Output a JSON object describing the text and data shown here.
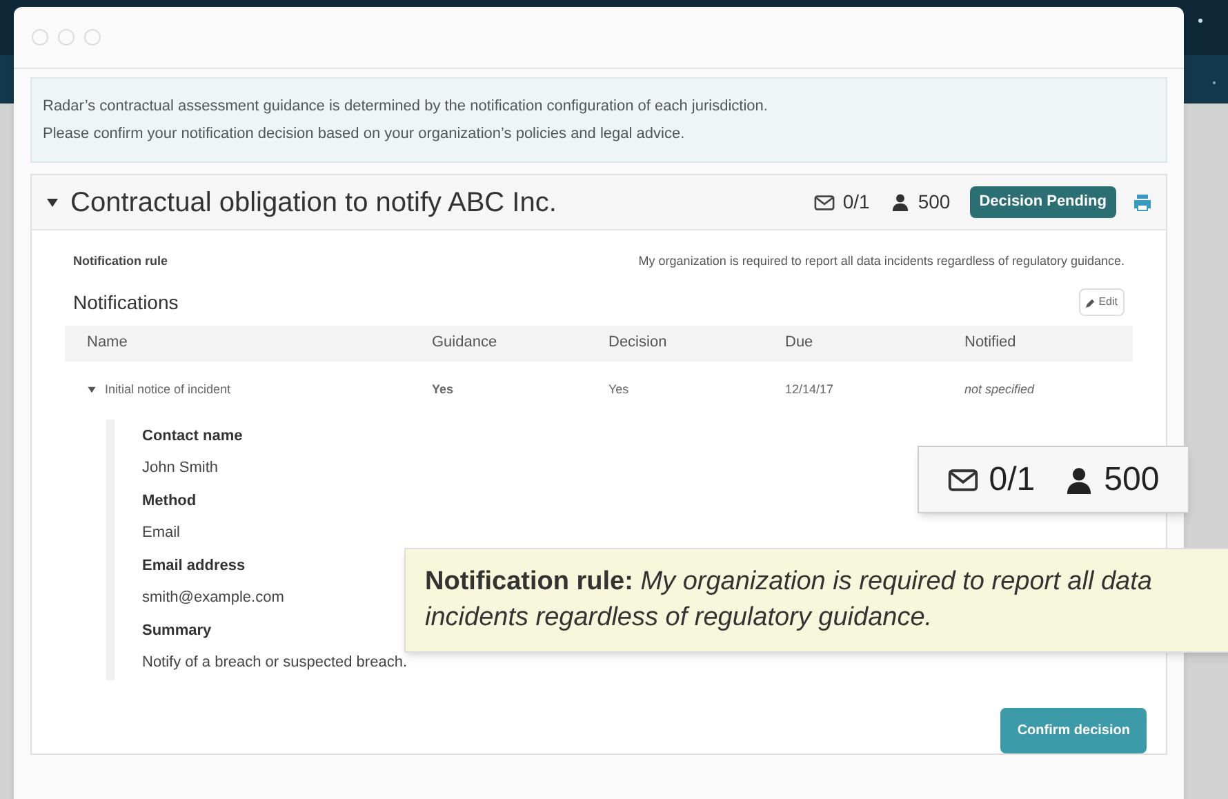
{
  "info": [
    "Radar’s contractual assessment guidance is determined by the notification configuration of each jurisdiction.",
    "Please confirm your notification decision based on your organization’s policies and legal advice."
  ],
  "card": {
    "title": "Contractual obligation to notify ABC Inc.",
    "expanded": true,
    "notified_count": "0/1",
    "people": "500",
    "status": "Decision Pending"
  },
  "rule": {
    "label": "Notification rule",
    "text": "My organization is required to report all data incidents regardless of regulatory guidance."
  },
  "notifications": {
    "heading": "Notifications",
    "edit": "Edit",
    "columns": [
      "Name",
      "Guidance",
      "Decision",
      "Due",
      "Notified"
    ],
    "rows": [
      {
        "expanded": true,
        "cells": [
          "Initial notice of incident",
          "Yes",
          "Yes",
          "12/14/17",
          "not specified"
        ],
        "details": [
          {
            "label": "Contact name",
            "value": "John Smith"
          },
          {
            "label": "Method",
            "value": "Email"
          },
          {
            "label": "Email address",
            "value": "smith@example.com"
          },
          {
            "label": "Summary",
            "value": "Notify of a breach or suspected breach."
          }
        ]
      }
    ]
  },
  "confirm_button": "Confirm decision",
  "callouts": {
    "stats": {
      "notified_count": "0/1",
      "people": "500"
    },
    "rule": "**Notification rule:** *My organization is required to report all data incidents regardless of regulatory guidance.*"
  }
}
